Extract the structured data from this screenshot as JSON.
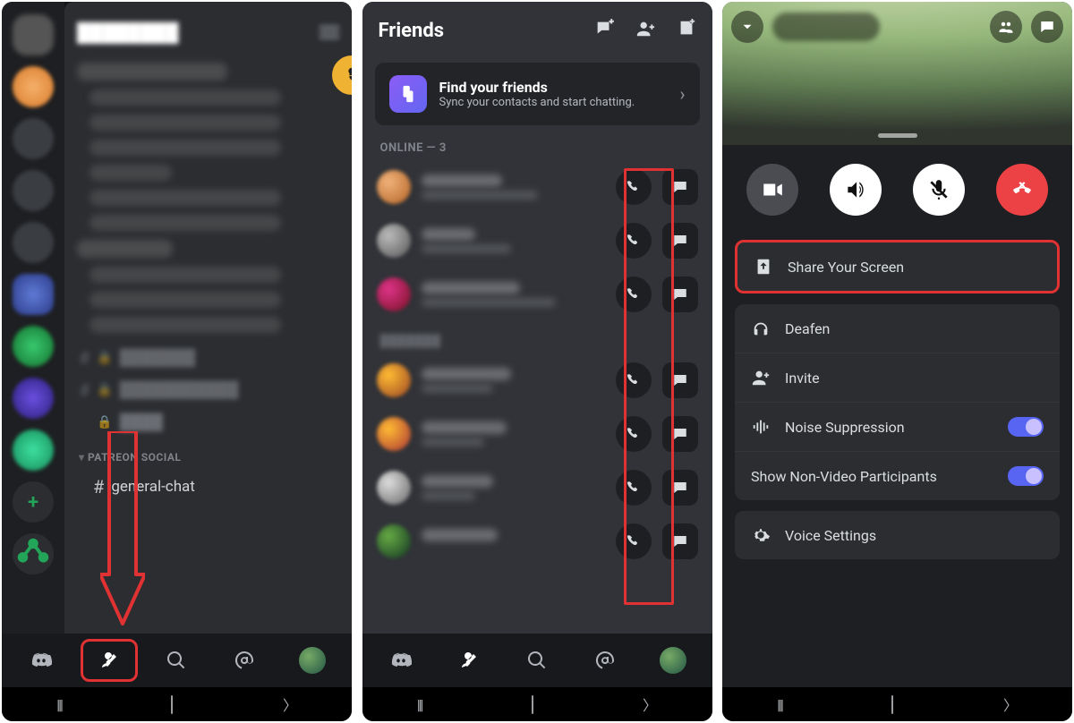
{
  "phone1": {
    "menu_aria": "menu",
    "categories": {
      "patreon_social": "PATREON SOCIAL"
    },
    "channels": {
      "general_chat": "general-chat"
    }
  },
  "phone2": {
    "header": {
      "title": "Friends"
    },
    "invite_card": {
      "title": "Find your friends",
      "subtitle": "Sync your contacts and start chatting."
    },
    "sections": {
      "online": "ONLINE — 3"
    }
  },
  "phone3": {
    "share_screen": "Share Your Screen",
    "deafen": "Deafen",
    "invite": "Invite",
    "noise_suppression": "Noise Suppression",
    "show_non_video": "Show Non-Video Participants",
    "voice_settings": "Voice Settings"
  }
}
